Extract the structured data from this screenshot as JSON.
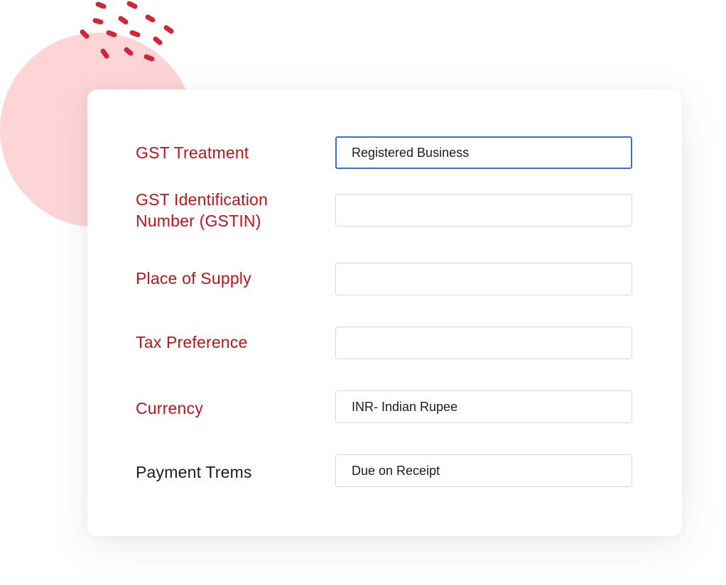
{
  "form": {
    "fields": [
      {
        "label": "GST Treatment",
        "value": "Registered Business"
      },
      {
        "label_line1": "GST Identification",
        "label_line2": "Number (GSTIN)",
        "value": ""
      },
      {
        "label": "Place of Supply",
        "value": ""
      },
      {
        "label": "Tax Preference",
        "value": ""
      },
      {
        "label": "Currency",
        "value": "INR- Indian Rupee"
      },
      {
        "label": "Payment Trems",
        "value": "Due on Receipt"
      }
    ]
  },
  "colors": {
    "label_red": "#c4121a",
    "label_dark": "#1c1c1c",
    "focus_border": "#3a6fd8",
    "field_border": "#d6d6d6",
    "decor_circle": "#fdd5d7",
    "decor_dots": "#d4243a"
  }
}
